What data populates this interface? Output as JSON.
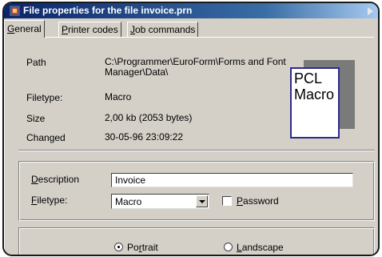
{
  "window": {
    "title": "File properties for the file invoice.prn"
  },
  "tabs": [
    {
      "pre": "",
      "key": "G",
      "post": "eneral"
    },
    {
      "pre": "",
      "key": "P",
      "post": "rinter codes"
    },
    {
      "pre": "",
      "key": "J",
      "post": "ob commands"
    }
  ],
  "info": {
    "path_label": "Path",
    "path_value_line1": "C:\\Programmer\\EuroForm\\Forms and Font",
    "path_value_line2": "Manager\\Data\\",
    "filetype_label": "Filetype:",
    "filetype_value": "Macro",
    "size_label": "Size",
    "size_value": "2,00 kb (2053 bytes)",
    "changed_label": "Changed",
    "changed_value": "30-05-96 23:09:22"
  },
  "preview": {
    "line1": "PCL",
    "line2": "Macro"
  },
  "form": {
    "description_key": "D",
    "description_rest": "escription",
    "description_value": "Invoice",
    "filetype_key": "F",
    "filetype_rest": "iletype:",
    "filetype_selected": "Macro",
    "password_key": "P",
    "password_rest": "assword"
  },
  "orientation": {
    "portrait_pre": "Po",
    "portrait_key": "r",
    "portrait_post": "trait",
    "landscape_key": "L",
    "landscape_rest": "andscape",
    "selected": "portrait"
  }
}
